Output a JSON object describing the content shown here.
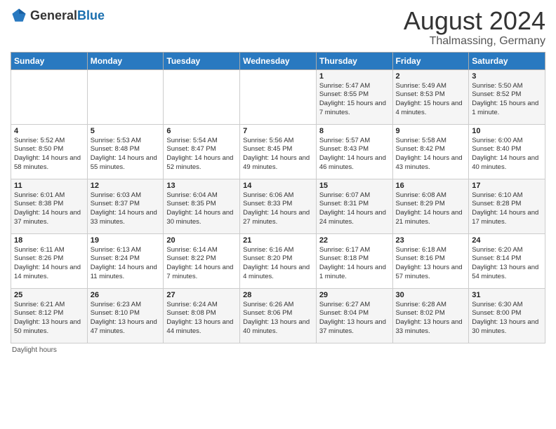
{
  "header": {
    "logo_general": "General",
    "logo_blue": "Blue",
    "month_title": "August 2024",
    "location": "Thalmassing, Germany"
  },
  "days_of_week": [
    "Sunday",
    "Monday",
    "Tuesday",
    "Wednesday",
    "Thursday",
    "Friday",
    "Saturday"
  ],
  "weeks": [
    [
      {
        "day": "",
        "info": ""
      },
      {
        "day": "",
        "info": ""
      },
      {
        "day": "",
        "info": ""
      },
      {
        "day": "",
        "info": ""
      },
      {
        "day": "1",
        "info": "Sunrise: 5:47 AM\nSunset: 8:55 PM\nDaylight: 15 hours and 7 minutes."
      },
      {
        "day": "2",
        "info": "Sunrise: 5:49 AM\nSunset: 8:53 PM\nDaylight: 15 hours and 4 minutes."
      },
      {
        "day": "3",
        "info": "Sunrise: 5:50 AM\nSunset: 8:52 PM\nDaylight: 15 hours and 1 minute."
      }
    ],
    [
      {
        "day": "4",
        "info": "Sunrise: 5:52 AM\nSunset: 8:50 PM\nDaylight: 14 hours and 58 minutes."
      },
      {
        "day": "5",
        "info": "Sunrise: 5:53 AM\nSunset: 8:48 PM\nDaylight: 14 hours and 55 minutes."
      },
      {
        "day": "6",
        "info": "Sunrise: 5:54 AM\nSunset: 8:47 PM\nDaylight: 14 hours and 52 minutes."
      },
      {
        "day": "7",
        "info": "Sunrise: 5:56 AM\nSunset: 8:45 PM\nDaylight: 14 hours and 49 minutes."
      },
      {
        "day": "8",
        "info": "Sunrise: 5:57 AM\nSunset: 8:43 PM\nDaylight: 14 hours and 46 minutes."
      },
      {
        "day": "9",
        "info": "Sunrise: 5:58 AM\nSunset: 8:42 PM\nDaylight: 14 hours and 43 minutes."
      },
      {
        "day": "10",
        "info": "Sunrise: 6:00 AM\nSunset: 8:40 PM\nDaylight: 14 hours and 40 minutes."
      }
    ],
    [
      {
        "day": "11",
        "info": "Sunrise: 6:01 AM\nSunset: 8:38 PM\nDaylight: 14 hours and 37 minutes."
      },
      {
        "day": "12",
        "info": "Sunrise: 6:03 AM\nSunset: 8:37 PM\nDaylight: 14 hours and 33 minutes."
      },
      {
        "day": "13",
        "info": "Sunrise: 6:04 AM\nSunset: 8:35 PM\nDaylight: 14 hours and 30 minutes."
      },
      {
        "day": "14",
        "info": "Sunrise: 6:06 AM\nSunset: 8:33 PM\nDaylight: 14 hours and 27 minutes."
      },
      {
        "day": "15",
        "info": "Sunrise: 6:07 AM\nSunset: 8:31 PM\nDaylight: 14 hours and 24 minutes."
      },
      {
        "day": "16",
        "info": "Sunrise: 6:08 AM\nSunset: 8:29 PM\nDaylight: 14 hours and 21 minutes."
      },
      {
        "day": "17",
        "info": "Sunrise: 6:10 AM\nSunset: 8:28 PM\nDaylight: 14 hours and 17 minutes."
      }
    ],
    [
      {
        "day": "18",
        "info": "Sunrise: 6:11 AM\nSunset: 8:26 PM\nDaylight: 14 hours and 14 minutes."
      },
      {
        "day": "19",
        "info": "Sunrise: 6:13 AM\nSunset: 8:24 PM\nDaylight: 14 hours and 11 minutes."
      },
      {
        "day": "20",
        "info": "Sunrise: 6:14 AM\nSunset: 8:22 PM\nDaylight: 14 hours and 7 minutes."
      },
      {
        "day": "21",
        "info": "Sunrise: 6:16 AM\nSunset: 8:20 PM\nDaylight: 14 hours and 4 minutes."
      },
      {
        "day": "22",
        "info": "Sunrise: 6:17 AM\nSunset: 8:18 PM\nDaylight: 14 hours and 1 minute."
      },
      {
        "day": "23",
        "info": "Sunrise: 6:18 AM\nSunset: 8:16 PM\nDaylight: 13 hours and 57 minutes."
      },
      {
        "day": "24",
        "info": "Sunrise: 6:20 AM\nSunset: 8:14 PM\nDaylight: 13 hours and 54 minutes."
      }
    ],
    [
      {
        "day": "25",
        "info": "Sunrise: 6:21 AM\nSunset: 8:12 PM\nDaylight: 13 hours and 50 minutes."
      },
      {
        "day": "26",
        "info": "Sunrise: 6:23 AM\nSunset: 8:10 PM\nDaylight: 13 hours and 47 minutes."
      },
      {
        "day": "27",
        "info": "Sunrise: 6:24 AM\nSunset: 8:08 PM\nDaylight: 13 hours and 44 minutes."
      },
      {
        "day": "28",
        "info": "Sunrise: 6:26 AM\nSunset: 8:06 PM\nDaylight: 13 hours and 40 minutes."
      },
      {
        "day": "29",
        "info": "Sunrise: 6:27 AM\nSunset: 8:04 PM\nDaylight: 13 hours and 37 minutes."
      },
      {
        "day": "30",
        "info": "Sunrise: 6:28 AM\nSunset: 8:02 PM\nDaylight: 13 hours and 33 minutes."
      },
      {
        "day": "31",
        "info": "Sunrise: 6:30 AM\nSunset: 8:00 PM\nDaylight: 13 hours and 30 minutes."
      }
    ]
  ],
  "footer": "Daylight hours"
}
